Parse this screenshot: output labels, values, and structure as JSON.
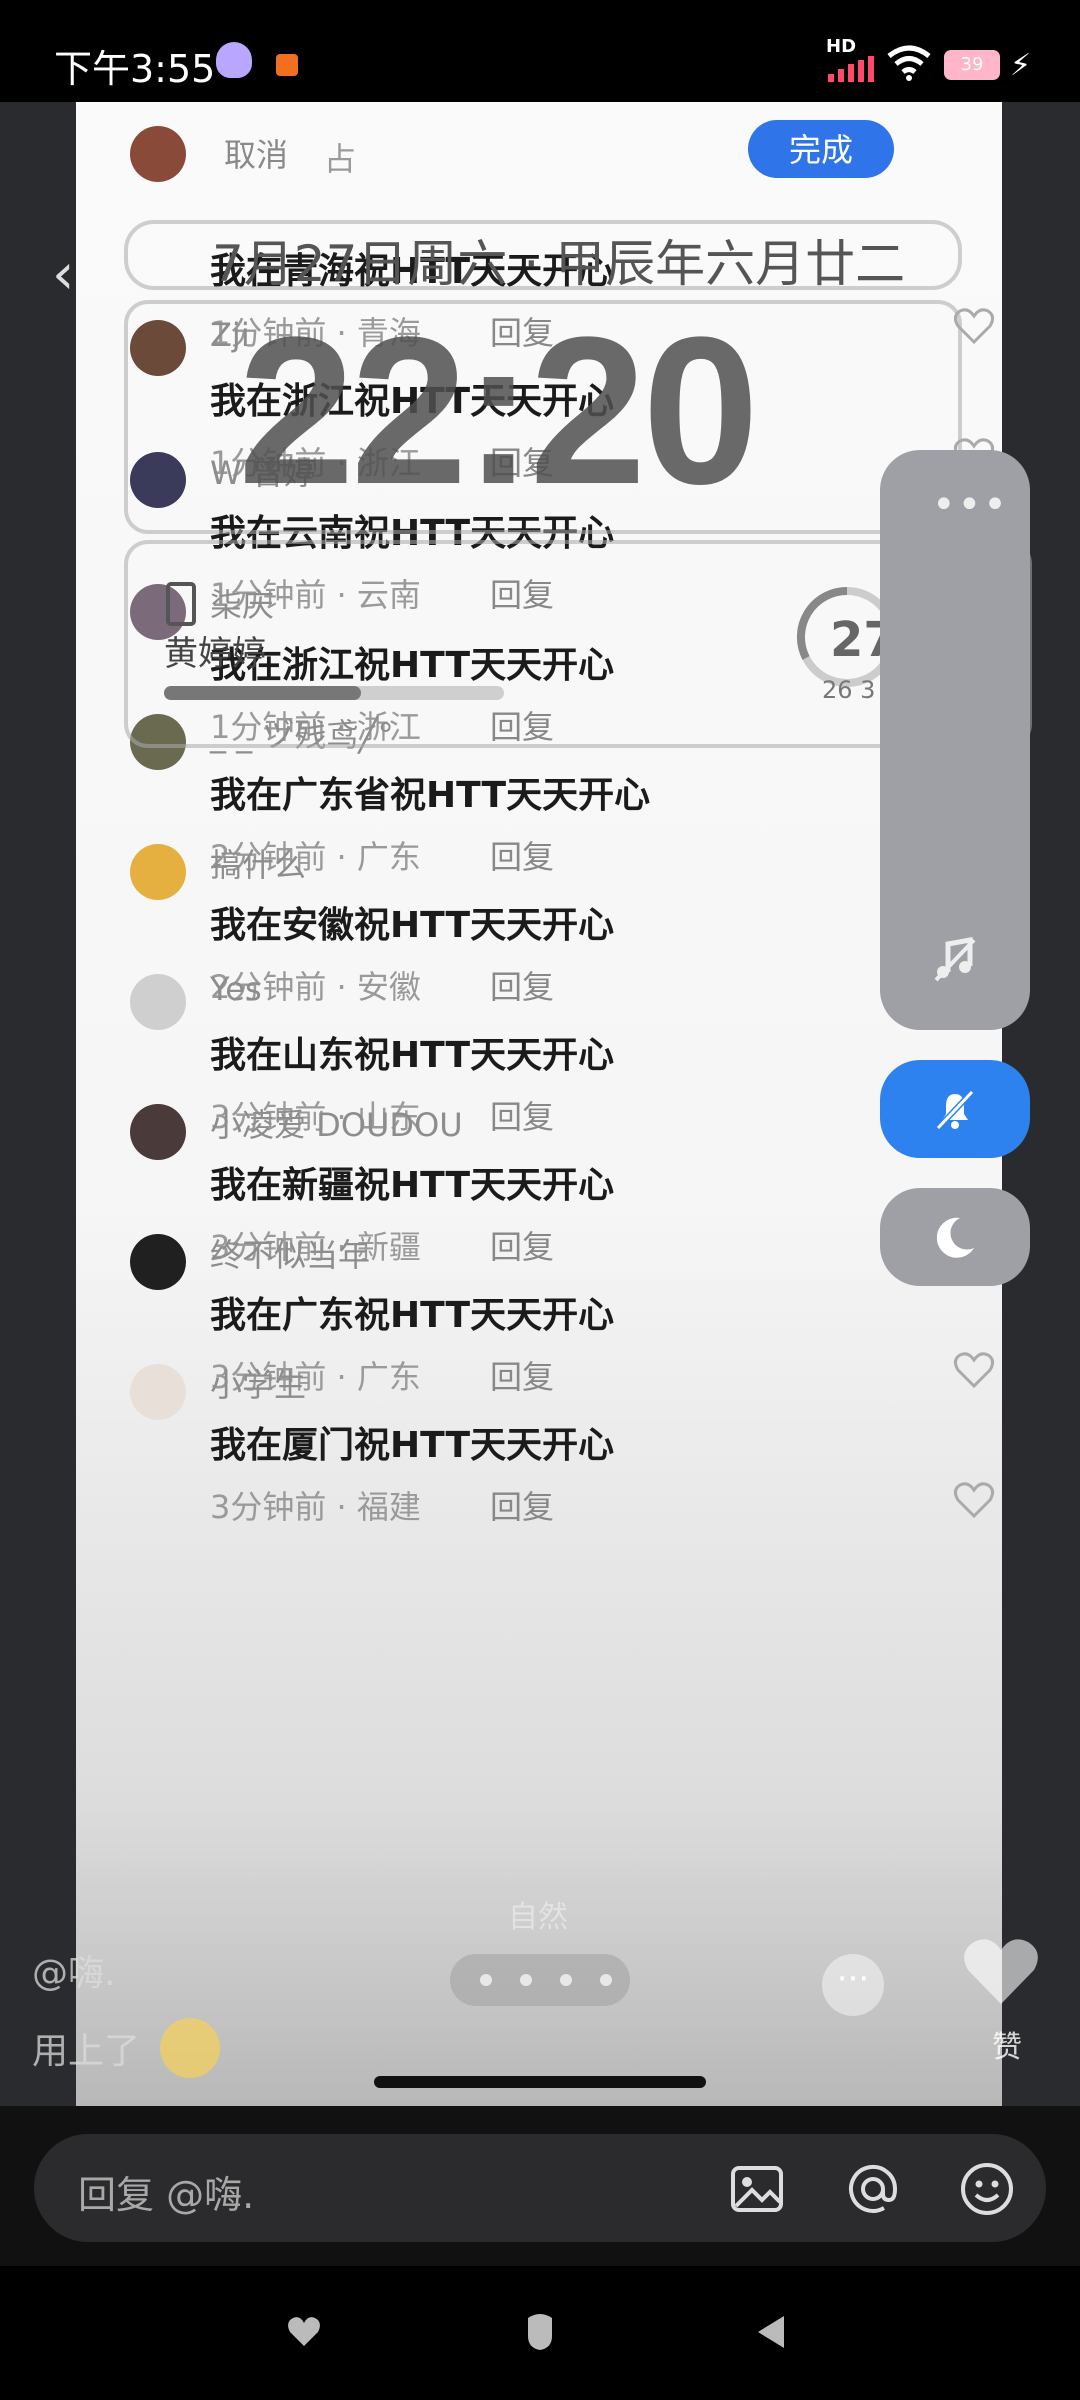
{
  "status_bar": {
    "time": "下午3:55",
    "network": "HD",
    "battery": "39"
  },
  "sheet": {
    "cancel": "取消",
    "partial": "占",
    "done": "完成"
  },
  "widgets": {
    "date": "7月27日周六 · 甲辰年六月廿二",
    "clock": "22:20",
    "battery_owner": "黄婷婷",
    "battery_level": 0.58,
    "ring_value": "27",
    "ring_sub": "26  3"
  },
  "comments": [
    {
      "user": "",
      "text": "我在青海祝HTT天天开心",
      "time": "1分钟前 · 青海",
      "reply": "回复",
      "avatar_color": "#8a4a3a"
    },
    {
      "user": "Zji",
      "text": "我在浙江祝HTT天天开心",
      "time": "1分钟前 · 浙江",
      "reply": "回复",
      "avatar_color": "#6b4a3a"
    },
    {
      "user": "W 曾婷",
      "text": "我在云南祝HTT天天开心",
      "time": "1分钟前 · 云南",
      "reply": "回复",
      "avatar_color": "#3a3a5a"
    },
    {
      "user": "柒庆",
      "text": "我在浙江祝HTT天天开心",
      "time": "1分钟前 · 浙江",
      "reply": "回复",
      "avatar_color": "#7a6a7a"
    },
    {
      "user": "_ _ ヅ残鸢╱°",
      "text": "我在广东省祝HTT天天开心",
      "time": "2分钟前 · 广东",
      "reply": "回复",
      "avatar_color": "#6a6a50"
    },
    {
      "user": "搞什么",
      "text": "我在安徽祝HTT天天开心",
      "time": "2分钟前 · 安徽",
      "reply": "回复",
      "avatar_color": "#e6b040"
    },
    {
      "user": "Yes",
      "text": "我在山东祝HTT天天开心",
      "time": "3分钟前 · 山东",
      "reply": "回复",
      "avatar_color": "#cfcfcf"
    },
    {
      "user": "小凌爱 DOUDOU",
      "text": "我在新疆祝HTT天天开心",
      "time": "3分钟前 · 新疆",
      "reply": "回复",
      "avatar_color": "#4a3a3a"
    },
    {
      "user": "终不似当年",
      "text": "我在广东祝HTT天天开心",
      "time": "3分钟前 · 广东",
      "reply": "回复",
      "avatar_color": "#202020"
    },
    {
      "user": "小学生",
      "text": "我在厦门祝HTT天天开心",
      "time": "3分钟前 · 福建",
      "reply": "回复",
      "avatar_color": "#e8e0d8"
    }
  ],
  "overlay": {
    "user": "@嗨.",
    "used": "用上了",
    "nature": "自然",
    "like": "赞"
  },
  "reply_bar": {
    "placeholder": "回复 @嗨."
  }
}
